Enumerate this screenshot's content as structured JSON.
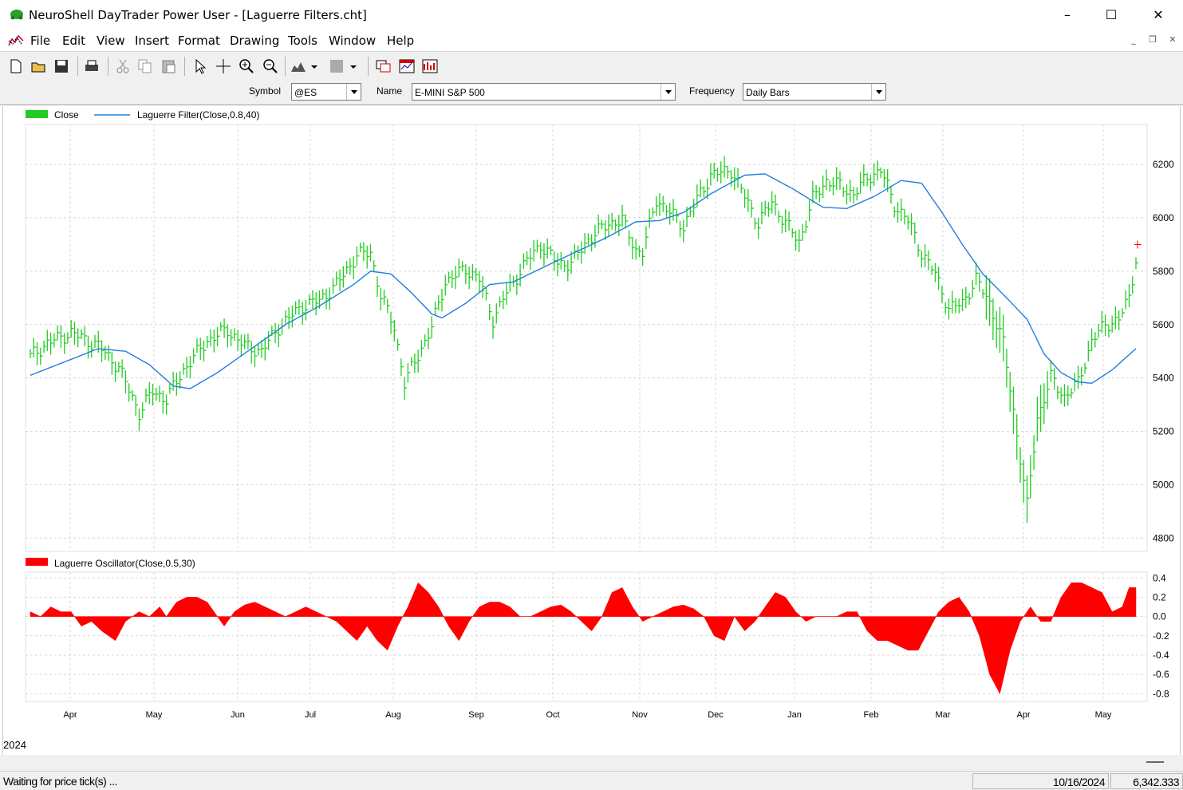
{
  "window": {
    "title": "NeuroShell DayTrader Power User - [Laguerre Filters.cht]",
    "minimize": "–",
    "maximize": "☐",
    "close": "✕"
  },
  "menu": [
    "File",
    "Edit",
    "View",
    "Insert",
    "Format",
    "Drawing",
    "Tools",
    "Window",
    "Help"
  ],
  "toolbar_icons": [
    "new-icon",
    "open-icon",
    "save-icon",
    "print-icon",
    "cut-icon",
    "copy-icon",
    "paste-icon",
    "pointer-icon",
    "crosshair-icon",
    "zoom-in-icon",
    "zoom-out-icon",
    "chart-type-icon",
    "dropdown-icon",
    "pattern-icon",
    "dropdown-icon",
    "window-icon",
    "chart-window-icon",
    "indicator-icon"
  ],
  "symbol_bar": {
    "symbol_label": "Symbol",
    "symbol_value": "@ES",
    "name_label": "Name",
    "name_value": "E-MINI S&P 500",
    "frequency_label": "Frequency",
    "frequency_value": "Daily Bars"
  },
  "colors": {
    "price": "#22cc22",
    "filter": "#1e7fe0",
    "oscillator": "#ff0000",
    "grid": "#d8d8d8"
  },
  "year_label": "2024",
  "status": {
    "message": "Waiting for price tick(s) ...",
    "date": "10/16/2024",
    "value": "6,342.333"
  },
  "chart_data": [
    {
      "type": "line",
      "legend": [
        {
          "name": "Close",
          "style": "bar"
        },
        {
          "name": "Laguerre Filter(Close,0.8,40)",
          "style": "line"
        }
      ],
      "ylim": [
        4750,
        6350
      ],
      "yticks": [
        "6200",
        "6000",
        "5800",
        "5600",
        "5400",
        "5200",
        "5000",
        "4800"
      ],
      "xticks": [
        "Apr",
        "May",
        "Jun",
        "Jul",
        "Aug",
        "Sep",
        "Oct",
        "Nov",
        "Dec",
        "Jan",
        "Feb",
        "Mar",
        "Apr",
        "May"
      ],
      "series": [
        {
          "name": "Close",
          "kind": "bars",
          "anchors": [
            [
              0,
              5480
            ],
            [
              5,
              5530
            ],
            [
              12,
              5570
            ],
            [
              20,
              5520
            ],
            [
              26,
              5440
            ],
            [
              32,
              5270
            ],
            [
              36,
              5350
            ],
            [
              40,
              5320
            ],
            [
              45,
              5430
            ],
            [
              52,
              5540
            ],
            [
              58,
              5580
            ],
            [
              63,
              5520
            ],
            [
              68,
              5500
            ],
            [
              73,
              5590
            ],
            [
              80,
              5670
            ],
            [
              85,
              5690
            ],
            [
              90,
              5750
            ],
            [
              96,
              5860
            ],
            [
              100,
              5870
            ],
            [
              103,
              5710
            ],
            [
              107,
              5590
            ],
            [
              110,
              5380
            ],
            [
              113,
              5460
            ],
            [
              118,
              5590
            ],
            [
              122,
              5760
            ],
            [
              128,
              5810
            ],
            [
              132,
              5770
            ],
            [
              136,
              5620
            ],
            [
              140,
              5720
            ],
            [
              146,
              5840
            ],
            [
              150,
              5900
            ],
            [
              155,
              5830
            ],
            [
              159,
              5830
            ],
            [
              164,
              5920
            ],
            [
              170,
              5980
            ],
            [
              174,
              5990
            ],
            [
              178,
              5880
            ],
            [
              180,
              5870
            ],
            [
              184,
              6070
            ],
            [
              188,
              6020
            ],
            [
              192,
              5970
            ],
            [
              196,
              6070
            ],
            [
              200,
              6160
            ],
            [
              206,
              6180
            ],
            [
              210,
              6080
            ],
            [
              214,
              5980
            ],
            [
              218,
              6060
            ],
            [
              222,
              5980
            ],
            [
              226,
              5910
            ],
            [
              230,
              6070
            ],
            [
              234,
              6140
            ],
            [
              238,
              6120
            ],
            [
              242,
              6090
            ],
            [
              246,
              6150
            ],
            [
              250,
              6180
            ],
            [
              254,
              6050
            ],
            [
              258,
              5990
            ],
            [
              262,
              5870
            ],
            [
              266,
              5790
            ],
            [
              270,
              5660
            ],
            [
              274,
              5680
            ],
            [
              278,
              5770
            ],
            [
              282,
              5680
            ],
            [
              286,
              5530
            ],
            [
              290,
              5190
            ],
            [
              293,
              4920
            ],
            [
              296,
              5250
            ],
            [
              300,
              5400
            ],
            [
              304,
              5330
            ],
            [
              308,
              5380
            ],
            [
              312,
              5540
            ],
            [
              316,
              5600
            ],
            [
              320,
              5620
            ],
            [
              323,
              5700
            ],
            [
              325,
              5850
            ]
          ]
        },
        {
          "name": "Laguerre Filter(Close,0.8,40)",
          "kind": "line",
          "anchors": [
            [
              0,
              5410
            ],
            [
              20,
              5510
            ],
            [
              28,
              5500
            ],
            [
              35,
              5450
            ],
            [
              42,
              5370
            ],
            [
              47,
              5360
            ],
            [
              55,
              5420
            ],
            [
              65,
              5510
            ],
            [
              75,
              5600
            ],
            [
              85,
              5670
            ],
            [
              95,
              5750
            ],
            [
              100,
              5800
            ],
            [
              106,
              5790
            ],
            [
              112,
              5720
            ],
            [
              118,
              5640
            ],
            [
              121,
              5625
            ],
            [
              128,
              5680
            ],
            [
              135,
              5750
            ],
            [
              142,
              5760
            ],
            [
              150,
              5810
            ],
            [
              160,
              5870
            ],
            [
              170,
              5930
            ],
            [
              178,
              5985
            ],
            [
              185,
              5990
            ],
            [
              192,
              6020
            ],
            [
              200,
              6090
            ],
            [
              210,
              6160
            ],
            [
              216,
              6165
            ],
            [
              224,
              6110
            ],
            [
              233,
              6040
            ],
            [
              240,
              6035
            ],
            [
              248,
              6080
            ],
            [
              256,
              6140
            ],
            [
              262,
              6130
            ],
            [
              268,
              6020
            ],
            [
              274,
              5900
            ],
            [
              280,
              5790
            ],
            [
              287,
              5700
            ],
            [
              293,
              5620
            ],
            [
              298,
              5490
            ],
            [
              303,
              5420
            ],
            [
              308,
              5385
            ],
            [
              312,
              5380
            ],
            [
              318,
              5430
            ],
            [
              325,
              5510
            ]
          ]
        }
      ]
    },
    {
      "type": "area",
      "legend": [
        {
          "name": "Laguerre Oscillator(Close,0.5,30)",
          "style": "bar"
        }
      ],
      "ylim": [
        -0.88,
        0.46
      ],
      "yticks": [
        "0.4",
        "0.2",
        "0.0",
        "-0.2",
        "-0.4",
        "-0.6",
        "-0.8"
      ],
      "series": [
        {
          "name": "Laguerre Oscillator(Close,0.5,30)",
          "anchors": [
            [
              0,
              0.05
            ],
            [
              3,
              0.0
            ],
            [
              6,
              0.1
            ],
            [
              9,
              0.05
            ],
            [
              12,
              0.05
            ],
            [
              15,
              -0.1
            ],
            [
              18,
              -0.05
            ],
            [
              21,
              -0.15
            ],
            [
              25,
              -0.25
            ],
            [
              28,
              -0.05
            ],
            [
              32,
              0.05
            ],
            [
              35,
              -0.0
            ],
            [
              38,
              0.1
            ],
            [
              40,
              0.0
            ],
            [
              43,
              0.15
            ],
            [
              46,
              0.2
            ],
            [
              49,
              0.2
            ],
            [
              52,
              0.15
            ],
            [
              54,
              0.05
            ],
            [
              57,
              -0.1
            ],
            [
              60,
              0.05
            ],
            [
              63,
              0.12
            ],
            [
              66,
              0.15
            ],
            [
              69,
              0.1
            ],
            [
              72,
              0.05
            ],
            [
              75,
              0.0
            ],
            [
              78,
              0.05
            ],
            [
              81,
              0.1
            ],
            [
              84,
              0.05
            ],
            [
              87,
              0.0
            ],
            [
              90,
              -0.05
            ],
            [
              93,
              -0.15
            ],
            [
              96,
              -0.25
            ],
            [
              99,
              -0.1
            ],
            [
              102,
              -0.25
            ],
            [
              105,
              -0.35
            ],
            [
              108,
              -0.1
            ],
            [
              111,
              0.1
            ],
            [
              114,
              0.35
            ],
            [
              117,
              0.25
            ],
            [
              120,
              0.1
            ],
            [
              123,
              -0.1
            ],
            [
              126,
              -0.25
            ],
            [
              129,
              -0.05
            ],
            [
              132,
              0.1
            ],
            [
              135,
              0.15
            ],
            [
              138,
              0.15
            ],
            [
              141,
              0.1
            ],
            [
              144,
              0.0
            ],
            [
              147,
              0.0
            ],
            [
              150,
              0.05
            ],
            [
              153,
              0.1
            ],
            [
              156,
              0.12
            ],
            [
              159,
              0.05
            ],
            [
              162,
              -0.05
            ],
            [
              165,
              -0.15
            ],
            [
              168,
              0.0
            ],
            [
              171,
              0.25
            ],
            [
              174,
              0.3
            ],
            [
              177,
              0.1
            ],
            [
              180,
              -0.05
            ],
            [
              183,
              0.0
            ],
            [
              186,
              0.05
            ],
            [
              189,
              0.1
            ],
            [
              192,
              0.12
            ],
            [
              195,
              0.08
            ],
            [
              198,
              0.0
            ],
            [
              201,
              -0.2
            ],
            [
              204,
              -0.25
            ],
            [
              207,
              0.0
            ],
            [
              210,
              -0.15
            ],
            [
              213,
              -0.05
            ],
            [
              216,
              0.1
            ],
            [
              219,
              0.25
            ],
            [
              222,
              0.2
            ],
            [
              225,
              0.05
            ],
            [
              228,
              -0.05
            ],
            [
              231,
              0.0
            ],
            [
              234,
              0.0
            ],
            [
              237,
              0.0
            ],
            [
              240,
              0.05
            ],
            [
              243,
              0.05
            ],
            [
              246,
              -0.15
            ],
            [
              249,
              -0.25
            ],
            [
              252,
              -0.25
            ],
            [
              255,
              -0.3
            ],
            [
              258,
              -0.35
            ],
            [
              261,
              -0.35
            ],
            [
              264,
              -0.15
            ],
            [
              267,
              0.05
            ],
            [
              270,
              0.15
            ],
            [
              273,
              0.2
            ],
            [
              276,
              0.05
            ],
            [
              279,
              -0.2
            ],
            [
              282,
              -0.6
            ],
            [
              285,
              -0.8
            ],
            [
              288,
              -0.35
            ],
            [
              291,
              -0.05
            ],
            [
              294,
              0.1
            ],
            [
              297,
              -0.05
            ],
            [
              300,
              -0.05
            ],
            [
              303,
              0.2
            ],
            [
              306,
              0.35
            ],
            [
              309,
              0.35
            ],
            [
              312,
              0.3
            ],
            [
              315,
              0.25
            ],
            [
              318,
              0.05
            ],
            [
              321,
              0.1
            ],
            [
              323,
              0.3
            ]
          ]
        }
      ]
    }
  ]
}
